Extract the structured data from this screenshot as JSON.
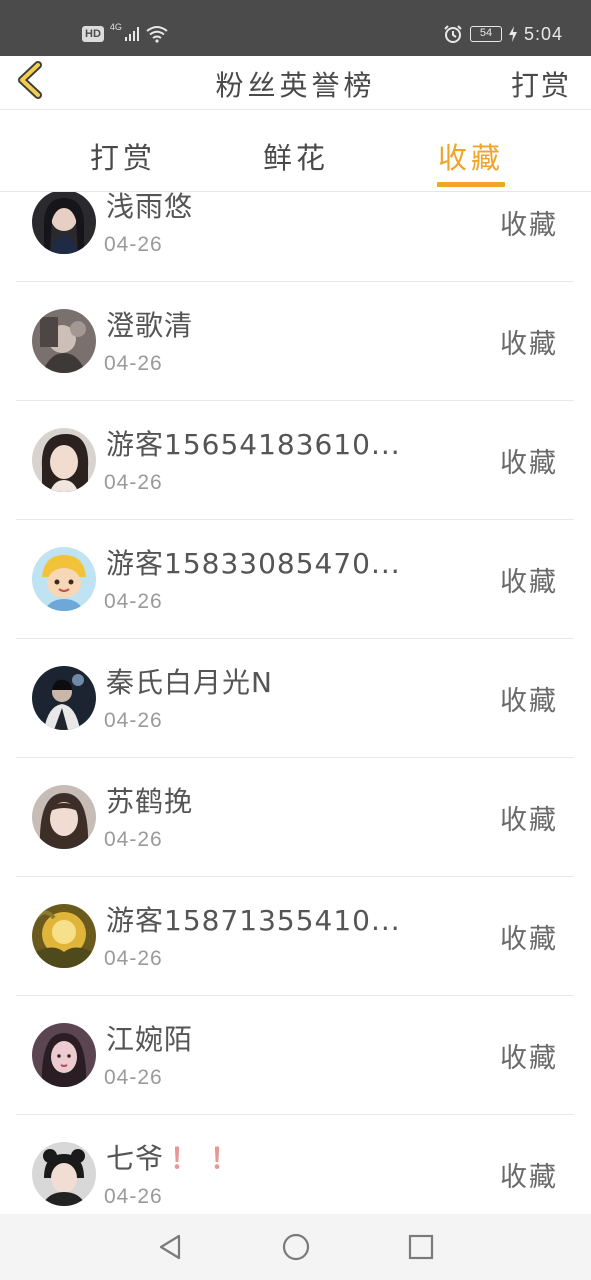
{
  "status_bar": {
    "hd": "HD",
    "network": "4G",
    "battery": "54",
    "time": "5:04",
    "icons": [
      "signal-icon",
      "wifi-icon",
      "alarm-icon",
      "battery-icon",
      "charging-icon"
    ]
  },
  "header": {
    "title": "粉丝英誉榜",
    "action": "打赏",
    "back_icon": "chevron-left-icon",
    "accent_color": "#f0a52a"
  },
  "tabs": [
    {
      "label": "打赏",
      "active": false
    },
    {
      "label": "鲜花",
      "active": false
    },
    {
      "label": "收藏",
      "active": true
    }
  ],
  "rows": [
    {
      "name": "浅雨悠",
      "date": "04-26",
      "type": "收藏"
    },
    {
      "name": "澄歌清",
      "date": "04-26",
      "type": "收藏"
    },
    {
      "name": "游客15654183610...",
      "date": "04-26",
      "type": "收藏"
    },
    {
      "name": "游客15833085470...",
      "date": "04-26",
      "type": "收藏"
    },
    {
      "name": "秦氏白月光N",
      "date": "04-26",
      "type": "收藏"
    },
    {
      "name": "苏鹤挽",
      "date": "04-26",
      "type": "收藏"
    },
    {
      "name": "游客15871355410...",
      "date": "04-26",
      "type": "收藏"
    },
    {
      "name": "江婉陌",
      "date": "04-26",
      "type": "收藏"
    },
    {
      "name": "七爷",
      "suffix": "！！",
      "date": "04-26",
      "type": "收藏"
    }
  ],
  "nav_bar": {
    "icons": [
      "back-triangle-icon",
      "home-circle-icon",
      "recents-square-icon"
    ]
  }
}
